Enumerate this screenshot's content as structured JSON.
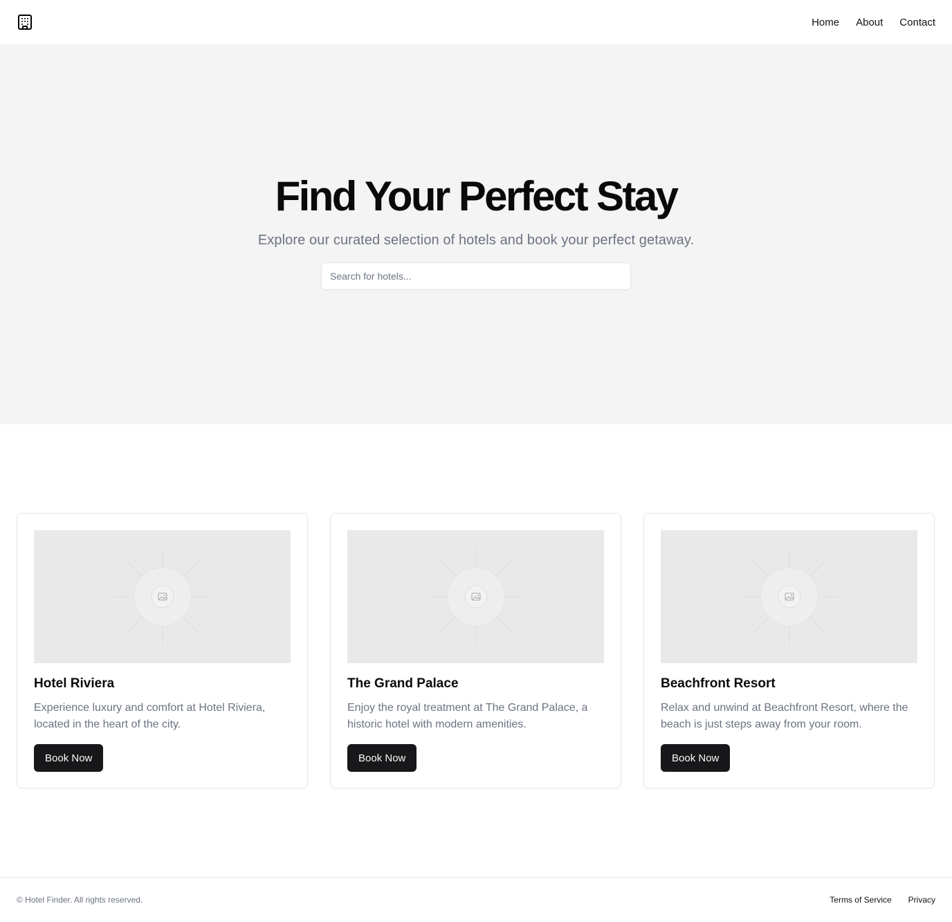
{
  "header": {
    "logo_icon": "hotel-building-icon",
    "nav": [
      {
        "label": "Home"
      },
      {
        "label": "About"
      },
      {
        "label": "Contact"
      }
    ]
  },
  "hero": {
    "title": "Find Your Perfect Stay",
    "subtitle": "Explore our curated selection of hotels and book your perfect getaway.",
    "search_placeholder": "Search for hotels..."
  },
  "hotels": [
    {
      "name": "Hotel Riviera",
      "description": "Experience luxury and comfort at Hotel Riviera, located in the heart of the city.",
      "button": "Book Now",
      "image_icon": "image-placeholder-icon"
    },
    {
      "name": "The Grand Palace",
      "description": "Enjoy the royal treatment at The Grand Palace, a historic hotel with modern amenities.",
      "button": "Book Now",
      "image_icon": "image-placeholder-icon"
    },
    {
      "name": "Beachfront Resort",
      "description": "Relax and unwind at Beachfront Resort, where the beach is just steps away from your room.",
      "button": "Book Now",
      "image_icon": "image-placeholder-icon"
    }
  ],
  "footer": {
    "copyright": "© Hotel Finder. All rights reserved.",
    "links": [
      {
        "label": "Terms of Service"
      },
      {
        "label": "Privacy"
      }
    ]
  },
  "colors": {
    "hero_bg": "#f4f4f4",
    "button_bg": "#18181b",
    "muted_text": "#6b7280",
    "image_bg": "#e9e9e9"
  }
}
